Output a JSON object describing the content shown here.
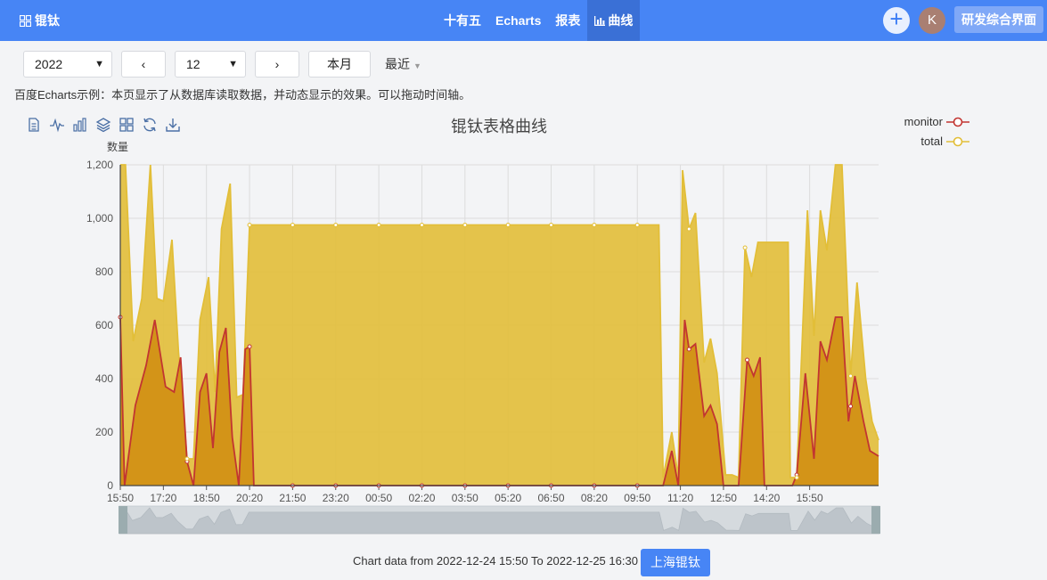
{
  "header": {
    "brand": "锟钛",
    "nav": [
      {
        "label": "十有五"
      },
      {
        "label": "Echarts"
      },
      {
        "label": "报表"
      },
      {
        "label": "曲线"
      }
    ],
    "plus": "+",
    "avatar": "K",
    "dev_button": "研发综合界面"
  },
  "controls": {
    "year": "2022",
    "prev": "‹",
    "month": "12",
    "next": "›",
    "this_month": "本月",
    "recent": "最近"
  },
  "description": "百度Echarts示例：本页显示了从数据库读取数据，并动态显示的效果。可以拖动时间轴。",
  "toolbox": [
    "data-view-icon",
    "line-chart-icon",
    "bar-chart-icon",
    "stack-icon",
    "tiled-icon",
    "restore-icon",
    "save-image-icon"
  ],
  "chart_data": {
    "type": "area",
    "title": "锟钛表格曲线",
    "ylabel": "数量",
    "ylim": [
      0,
      1200
    ],
    "yticks": [
      0,
      200,
      400,
      600,
      800,
      1000,
      1200
    ],
    "ytick_labels": [
      "0",
      "200",
      "400",
      "600",
      "800",
      "1,000",
      "1,200"
    ],
    "xticks": [
      "15:50",
      "17:20",
      "18:50",
      "20:20",
      "21:50",
      "23:20",
      "00:50",
      "02:20",
      "03:50",
      "05:20",
      "06:50",
      "08:20",
      "09:50",
      "11:20",
      "12:50",
      "14:20",
      "15:50"
    ],
    "legend_position": "top-right",
    "series": [
      {
        "name": "monitor",
        "color": "#c23531",
        "points": [
          [
            0,
            630
          ],
          [
            0.1,
            0
          ],
          [
            0.35,
            300
          ],
          [
            0.6,
            450
          ],
          [
            0.8,
            620
          ],
          [
            1.05,
            370
          ],
          [
            1.25,
            350
          ],
          [
            1.4,
            480
          ],
          [
            1.55,
            90
          ],
          [
            1.7,
            0
          ],
          [
            1.85,
            350
          ],
          [
            2.0,
            420
          ],
          [
            2.15,
            140
          ],
          [
            2.3,
            500
          ],
          [
            2.45,
            590
          ],
          [
            2.6,
            180
          ],
          [
            2.75,
            0
          ],
          [
            2.9,
            510
          ],
          [
            3.0,
            520
          ],
          [
            3.1,
            0
          ],
          [
            3.5,
            0
          ],
          [
            4,
            0
          ],
          [
            5,
            0
          ],
          [
            6,
            0
          ],
          [
            7,
            0
          ],
          [
            8,
            0
          ],
          [
            9,
            0
          ],
          [
            10,
            0
          ],
          [
            11,
            0
          ],
          [
            12,
            0
          ],
          [
            12.6,
            0
          ],
          [
            12.8,
            130
          ],
          [
            12.95,
            0
          ],
          [
            13.1,
            620
          ],
          [
            13.2,
            510
          ],
          [
            13.35,
            530
          ],
          [
            13.55,
            260
          ],
          [
            13.7,
            300
          ],
          [
            13.85,
            230
          ],
          [
            14.0,
            0
          ],
          [
            14.3,
            0
          ],
          [
            14.35,
            0
          ],
          [
            14.55,
            470
          ],
          [
            14.7,
            410
          ],
          [
            14.85,
            480
          ],
          [
            14.95,
            0
          ],
          [
            15.0,
            0
          ],
          [
            15.6,
            0
          ],
          [
            15.7,
            40
          ],
          [
            15.9,
            420
          ],
          [
            16.1,
            100
          ],
          [
            16.25,
            540
          ],
          [
            16.4,
            470
          ],
          [
            16.6,
            630
          ],
          [
            16.75,
            630
          ],
          [
            16.9,
            240
          ],
          [
            17.05,
            410
          ],
          [
            17.25,
            240
          ],
          [
            17.4,
            130
          ],
          [
            17.6,
            110
          ]
        ]
      },
      {
        "name": "total",
        "color": "#e2be38",
        "points": [
          [
            0,
            1200
          ],
          [
            0.12,
            1200
          ],
          [
            0.3,
            540
          ],
          [
            0.5,
            700
          ],
          [
            0.7,
            1200
          ],
          [
            0.85,
            700
          ],
          [
            1.0,
            690
          ],
          [
            1.2,
            920
          ],
          [
            1.35,
            500
          ],
          [
            1.55,
            100
          ],
          [
            1.7,
            100
          ],
          [
            1.85,
            620
          ],
          [
            2.05,
            780
          ],
          [
            2.2,
            350
          ],
          [
            2.35,
            960
          ],
          [
            2.55,
            1130
          ],
          [
            2.7,
            330
          ],
          [
            2.85,
            340
          ],
          [
            3.0,
            975
          ],
          [
            4,
            975
          ],
          [
            5,
            975
          ],
          [
            6,
            975
          ],
          [
            7,
            975
          ],
          [
            8,
            975
          ],
          [
            9,
            975
          ],
          [
            10,
            975
          ],
          [
            11,
            975
          ],
          [
            12,
            975
          ],
          [
            12.5,
            975
          ],
          [
            12.6,
            30
          ],
          [
            12.8,
            200
          ],
          [
            12.95,
            30
          ],
          [
            13.05,
            1180
          ],
          [
            13.2,
            960
          ],
          [
            13.35,
            1020
          ],
          [
            13.55,
            460
          ],
          [
            13.7,
            550
          ],
          [
            13.85,
            420
          ],
          [
            14.05,
            40
          ],
          [
            14.2,
            40
          ],
          [
            14.35,
            30
          ],
          [
            14.5,
            890
          ],
          [
            14.65,
            780
          ],
          [
            14.8,
            910
          ],
          [
            15.0,
            910
          ],
          [
            15.5,
            910
          ],
          [
            15.55,
            30
          ],
          [
            15.7,
            30
          ],
          [
            15.95,
            1030
          ],
          [
            16.1,
            560
          ],
          [
            16.25,
            1030
          ],
          [
            16.4,
            880
          ],
          [
            16.6,
            1200
          ],
          [
            16.75,
            1200
          ],
          [
            16.95,
            410
          ],
          [
            17.1,
            760
          ],
          [
            17.3,
            400
          ],
          [
            17.45,
            240
          ],
          [
            17.6,
            170
          ]
        ]
      }
    ],
    "dot_markers": {
      "monitor": [
        0,
        1.55,
        3.0,
        4,
        5,
        6,
        7,
        8,
        9,
        10,
        11,
        12,
        13.2,
        14.55,
        15.7,
        16.95
      ],
      "total": [
        1.55,
        3.0,
        4,
        5,
        6,
        7,
        8,
        9,
        10,
        11,
        12,
        13.2,
        14.5,
        15.7,
        16.95
      ]
    }
  },
  "footer": {
    "range_text": "Chart data from 2022-12-24 15:50 To 2022-12-25 16:30",
    "button": "上海锟钛"
  }
}
